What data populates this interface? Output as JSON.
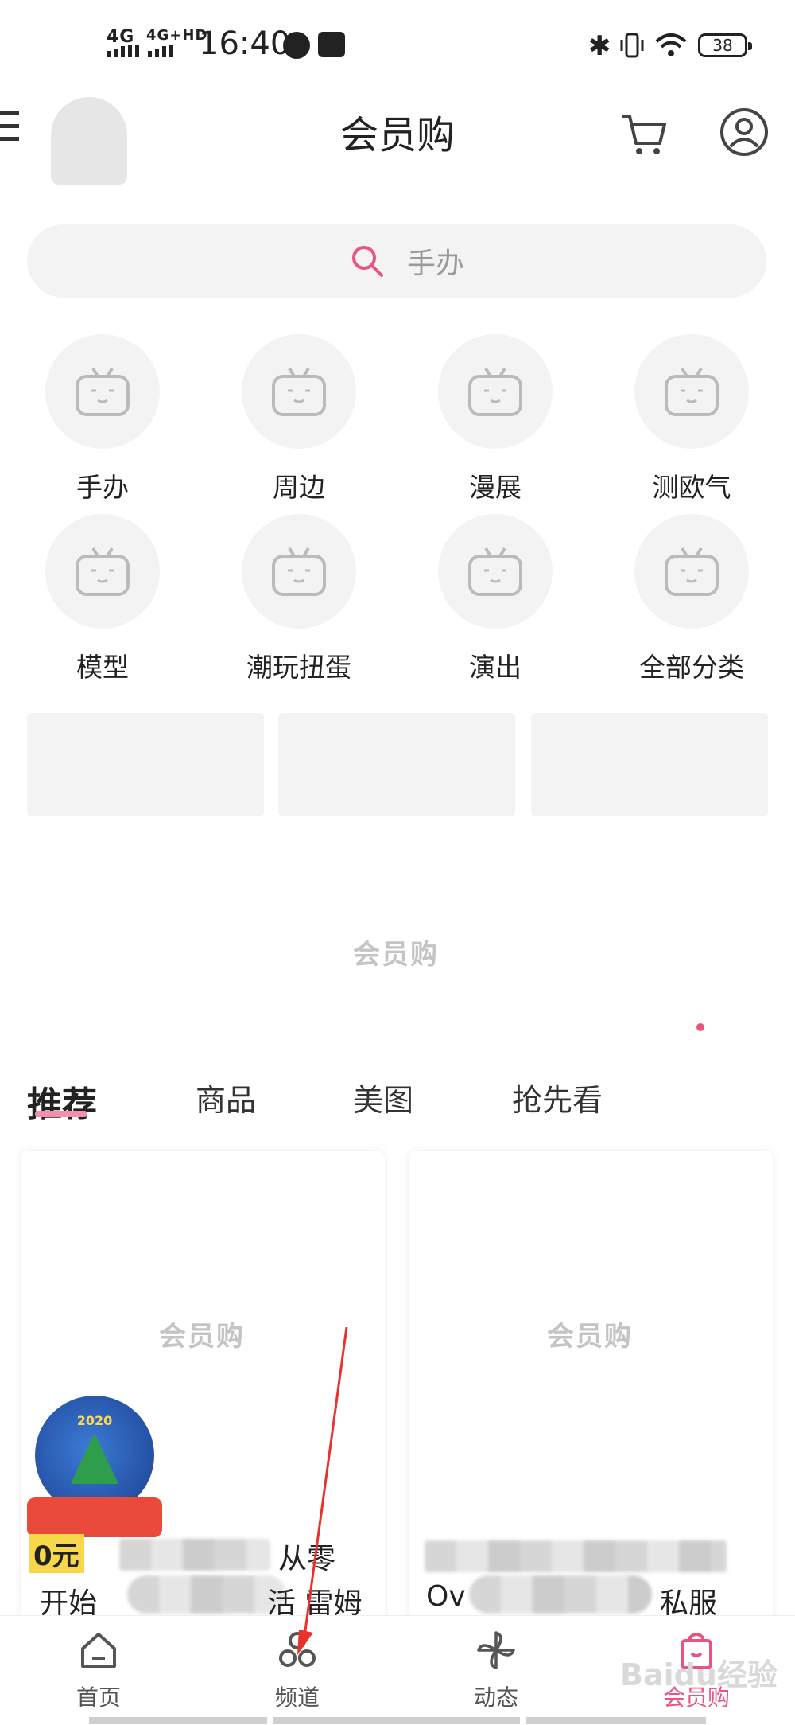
{
  "status_bar": {
    "signal1": "4G",
    "signal2": "4G+HD",
    "time": "16:40",
    "battery": "38"
  },
  "header": {
    "title": "会员购"
  },
  "search": {
    "placeholder": "手办"
  },
  "categories": [
    {
      "label": "手办"
    },
    {
      "label": "周边"
    },
    {
      "label": "漫展"
    },
    {
      "label": "测欧气"
    },
    {
      "label": "模型"
    },
    {
      "label": "潮玩扭蛋"
    },
    {
      "label": "演出"
    },
    {
      "label": "全部分类"
    }
  ],
  "placeholder_logo": "会员购",
  "tabs": [
    {
      "label": "推荐"
    },
    {
      "label": "商品"
    },
    {
      "label": "美图"
    },
    {
      "label": "抢先看"
    }
  ],
  "cards": [
    {
      "line1_end": "从零",
      "line2_start": "开始",
      "line2_end": "活 雷姆",
      "promo_text": "0元"
    },
    {
      "line2_start": "Ov",
      "line2_end": "私服"
    }
  ],
  "promo_year": "2020",
  "bottom_nav": [
    {
      "label": "首页",
      "icon": "home-icon"
    },
    {
      "label": "频道",
      "icon": "channel-icon"
    },
    {
      "label": "动态",
      "icon": "pinwheel-icon"
    },
    {
      "label": "会员购",
      "icon": "shopping-bag-icon",
      "active": true
    }
  ],
  "colors": {
    "accent": "#e9557f",
    "tab_underline": "#f28fac"
  },
  "watermark": "Baidu经验"
}
